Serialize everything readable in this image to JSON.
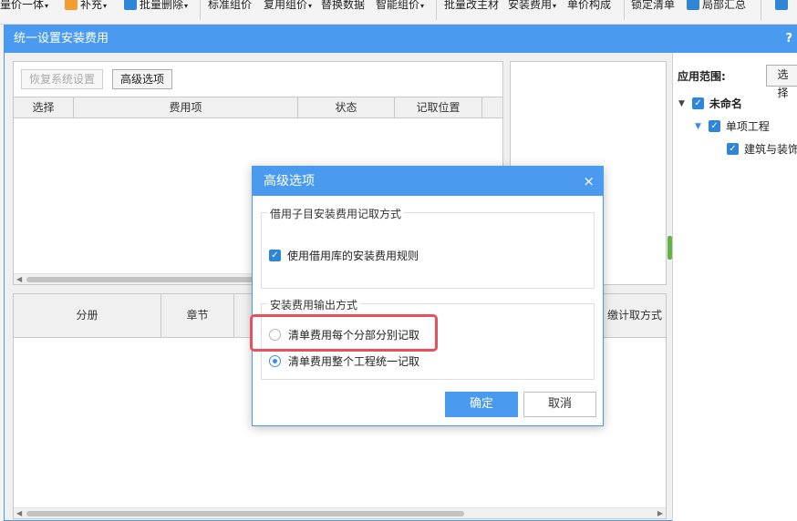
{
  "ribbon": {
    "items": [
      {
        "label": "量价一体",
        "caret": "▾"
      },
      {
        "label": "补充",
        "caret": "▾"
      },
      {
        "label": "批量删除",
        "caret": "▾"
      },
      {
        "label": "标准组价",
        "caret": ""
      },
      {
        "label": "复用组价",
        "caret": "▾"
      },
      {
        "label": "替换数据",
        "caret": ""
      },
      {
        "label": "智能组价",
        "caret": "▾"
      },
      {
        "label": "批量改主材",
        "caret": ""
      },
      {
        "label": "安装费用",
        "caret": "▾"
      },
      {
        "label": "单价构成",
        "caret": ""
      },
      {
        "label": "锁定清单",
        "caret": ""
      },
      {
        "label": "局部汇总",
        "caret": ""
      }
    ],
    "colors": {
      "icon_orange": "#f39c32",
      "icon_blue": "#2f86d8"
    }
  },
  "main_dialog": {
    "title": "统一设置安装费用",
    "help": "?",
    "restore_button": "恢复系统设置",
    "advanced_button": "高级选项",
    "upper_grid": {
      "columns": [
        "选择",
        "费用项",
        "状态",
        "记取位置"
      ]
    },
    "lower_grid": {
      "columns": [
        "分册",
        "章节",
        "",
        "",
        "",
        "缴计取方式"
      ]
    },
    "scope": {
      "label": "应用范围:",
      "select_button": "选择",
      "tree": [
        {
          "label": "未命名",
          "checked": true
        },
        {
          "label": "单项工程",
          "checked": true
        },
        {
          "label": "建筑与装饰工",
          "checked": true
        }
      ]
    }
  },
  "modal": {
    "title": "高级选项",
    "close_icon": "×",
    "section1": {
      "legend": "借用子目安装费用记取方式",
      "checkbox_label": "使用借用库的安装费用规则",
      "checked": true
    },
    "section2": {
      "legend": "安装费用输出方式",
      "options": [
        {
          "label": "清单费用每个分部分别记取",
          "selected": false
        },
        {
          "label": "清单费用整个工程统一记取",
          "selected": true
        }
      ]
    },
    "ok_label": "确定",
    "cancel_label": "取消"
  },
  "colors": {
    "accent": "#4a9bef",
    "highlight": "#e8505b",
    "check": "#2f86d8"
  }
}
